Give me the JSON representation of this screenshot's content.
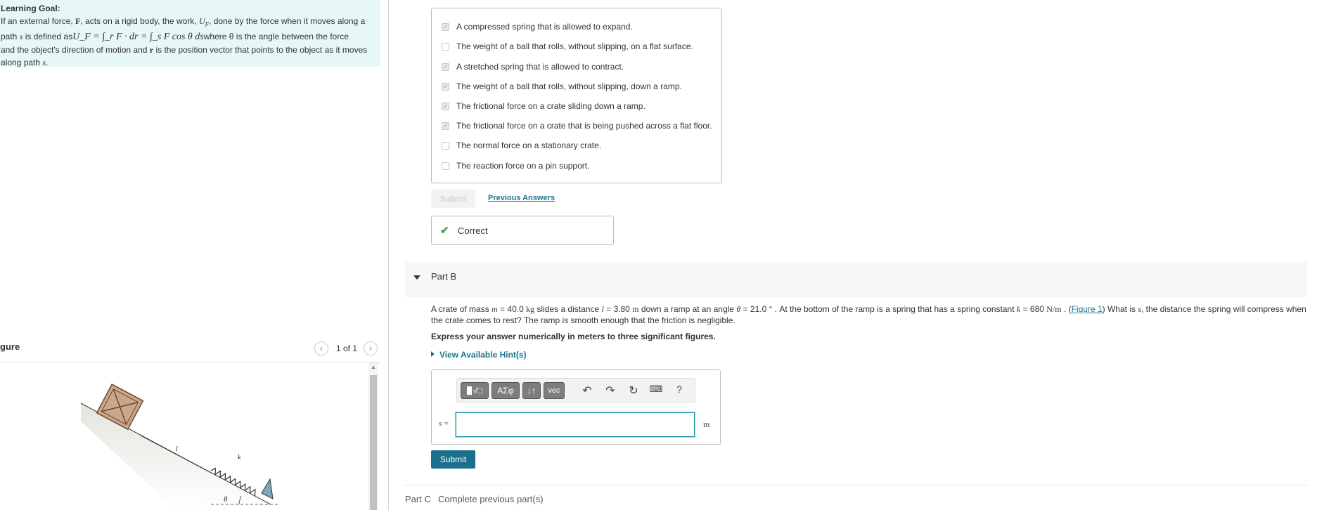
{
  "learning_goal": {
    "title": "Learning Goal:",
    "line1_pre": "If an external force, ",
    "force_symbol": "F",
    "line1_mid": ", acts on a rigid body, the work, ",
    "work_symbol": "U",
    "work_sub": "F",
    "line1_post": ", done by the force when it moves along a",
    "line2_pre": "path ",
    "path_symbol": "s",
    "line2_mid": " is defined as",
    "equation": "U_F = ∫_r F · dr = ∫_s F cos θ ds",
    "line2_post": "where θ is the angle between the force",
    "line3": "and the object's direction of motion and",
    "r_symbol": "r",
    "line3_post": " is the position vector that points to the object as it moves",
    "line4": "along path ",
    "line4_symbol": "s",
    "line4_end": "."
  },
  "figure": {
    "title": "gure",
    "count": "1 of 1",
    "prev_icon": "chevron-left-icon",
    "next_icon": "chevron-right-icon",
    "label_l": "l",
    "label_k": "k",
    "label_theta": "θ"
  },
  "part_a": {
    "choices": [
      {
        "label": "A compressed spring that is allowed to expand.",
        "checked": true
      },
      {
        "label": "The weight of a ball that rolls, without slipping, on a flat surface.",
        "checked": false
      },
      {
        "label": "A stretched spring that is allowed to contract.",
        "checked": true
      },
      {
        "label": "The weight of a ball that rolls, without slipping, down a ramp.",
        "checked": true
      },
      {
        "label": "The frictional force on a crate sliding down a ramp.",
        "checked": true
      },
      {
        "label": "The frictional force on a crate that is being pushed across a flat floor.",
        "checked": true
      },
      {
        "label": "The normal force on a stationary crate.",
        "checked": false
      },
      {
        "label": "The reaction force on a pin support.",
        "checked": false
      }
    ],
    "submit_label": "Submit",
    "previous_answers": "Previous Answers",
    "feedback": "Correct"
  },
  "part_b": {
    "label": "Part B",
    "problem": {
      "t1": "A crate of mass ",
      "m": "m",
      "t2": " = 40.0 ",
      "kg": "kg",
      "t3": " slides a distance ",
      "l": "l",
      "t4": " = 3.80 ",
      "m_unit": "m",
      "t5": " down a ramp at an angle ",
      "theta": "θ",
      "t6": " = 21.0 ° . At the bottom of the ramp is a spring that has a spring constant ",
      "k": "k",
      "t7": " = 680 ",
      "k_unit": "N/m",
      "t8": " . (",
      "fig_link": "Figure 1",
      "t9": ") What is ",
      "s": "s",
      "t10": ", the distance the spring will compress when the crate comes to rest? The ramp is smooth enough that the friction is negligible."
    },
    "instruction": "Express your answer numerically in meters to three significant figures.",
    "hint": "View Available Hint(s)",
    "toolbar": {
      "templates": "√□",
      "greek": "AΣφ",
      "arrows": "↓↑",
      "vec": "vec",
      "undo_icon": "undo-icon",
      "redo_icon": "redo-icon",
      "reset_icon": "reset-icon",
      "keyboard_icon": "keyboard-icon",
      "help": "?"
    },
    "answer_label": "s =",
    "answer_value": "",
    "unit": "m",
    "submit_label": "Submit"
  },
  "part_c": {
    "label": "Part C",
    "status": "Complete previous part(s)"
  }
}
